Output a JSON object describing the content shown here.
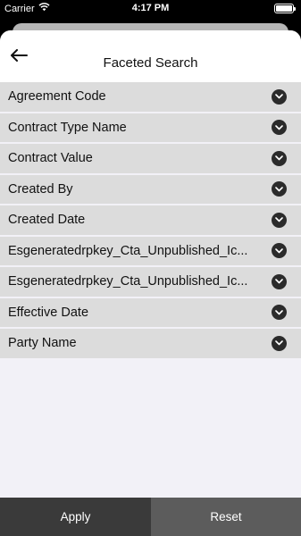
{
  "status_bar": {
    "carrier": "Carrier",
    "time": "4:17 PM"
  },
  "header": {
    "title": "Faceted Search",
    "back_icon": "arrow-left-icon"
  },
  "facets": [
    {
      "label": "Agreement Code"
    },
    {
      "label": "Contract Type Name"
    },
    {
      "label": "Contract Value"
    },
    {
      "label": "Created By"
    },
    {
      "label": "Created Date"
    },
    {
      "label": "Esgeneratedrpkey_Cta_Unpublished_Ic..."
    },
    {
      "label": "Esgeneratedrpkey_Cta_Unpublished_Ic..."
    },
    {
      "label": "Effective Date"
    },
    {
      "label": "Party Name"
    }
  ],
  "footer": {
    "apply_label": "Apply",
    "reset_label": "Reset"
  },
  "colors": {
    "row_bg": "#dcdcdc",
    "sheet_bg": "#f2f1f7",
    "apply_bg": "#3a3a3a",
    "reset_bg": "#5c5c5c",
    "chevron_bg": "#2b2b2b"
  }
}
